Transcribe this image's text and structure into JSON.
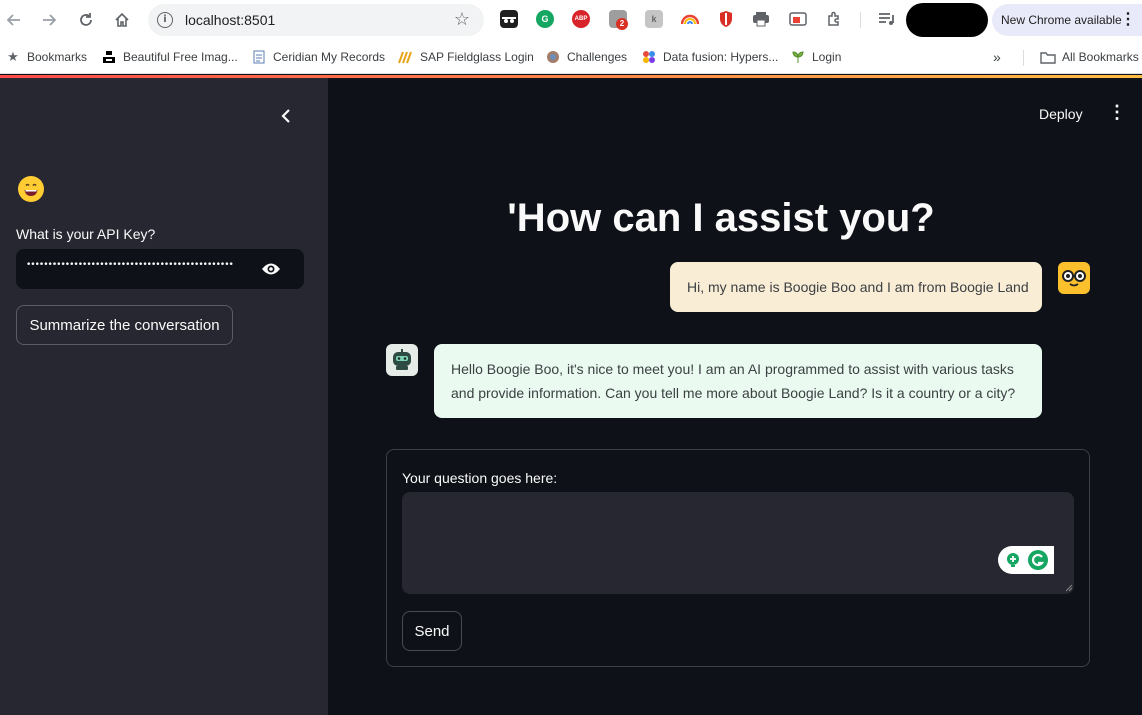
{
  "browser": {
    "url": "localhost:8501",
    "update_label": "New Chrome available",
    "extension_badge": "2",
    "abp_label": "ABP"
  },
  "bookmarks": {
    "items": [
      "Bookmarks",
      "Beautiful Free Imag...",
      "Ceridian My Records",
      "SAP Fieldglass Login",
      "Challenges",
      "Data fusion: Hypers...",
      "Login"
    ],
    "more": "»",
    "all": "All Bookmarks"
  },
  "sidebar": {
    "emoji": "😄",
    "api_label": "What is your API Key?",
    "api_value": "••••••••••••••••••••••••••••••••••••••••••••••••",
    "summarize_label": "Summarize the conversation"
  },
  "main": {
    "deploy_label": "Deploy",
    "title": "'How can I assist you?",
    "messages": {
      "user": "Hi, my name is Boogie Boo and I am from Boogie Land",
      "assistant": "Hello Boogie Boo, it's nice to meet you! I am an AI programmed to assist with various tasks and provide information. Can you tell me more about Boogie Land? Is it a country or a city?"
    },
    "form": {
      "label": "Your question goes here:",
      "value": "",
      "send_label": "Send"
    }
  }
}
